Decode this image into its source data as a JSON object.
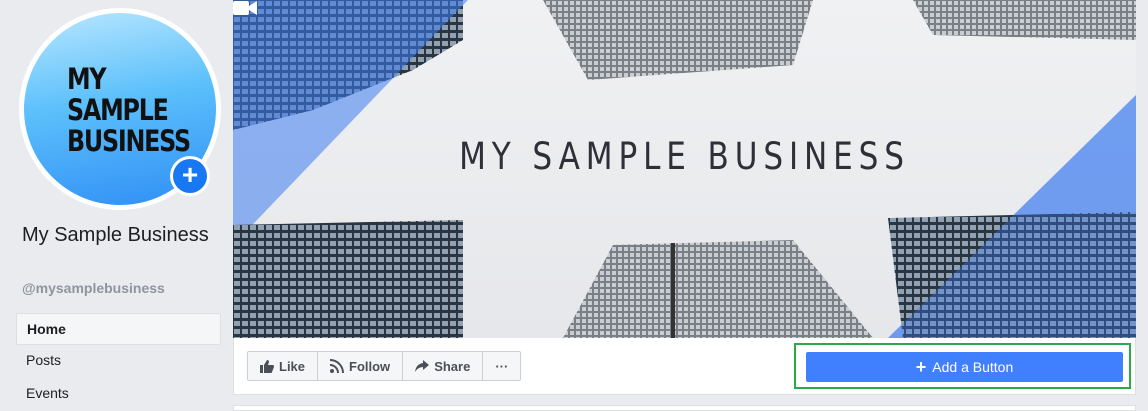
{
  "page": {
    "avatar_text": [
      "MY",
      "SAMPLE",
      "BUSINESS"
    ],
    "name": "My Sample Business",
    "handle": "@mysamplebusiness"
  },
  "nav": {
    "items": [
      {
        "label": "Home",
        "active": true
      },
      {
        "label": "Posts",
        "active": false
      },
      {
        "label": "Events",
        "active": false
      }
    ]
  },
  "cover": {
    "title": "MY SAMPLE BUSINESS",
    "icon": "video-camera-icon"
  },
  "actions": {
    "like": "Like",
    "follow": "Follow",
    "share": "Share",
    "more": "···",
    "add_button": "Add a Button"
  },
  "colors": {
    "accent": "#4080ff",
    "brand": "#1877f2",
    "highlight": "#2ea84b"
  }
}
